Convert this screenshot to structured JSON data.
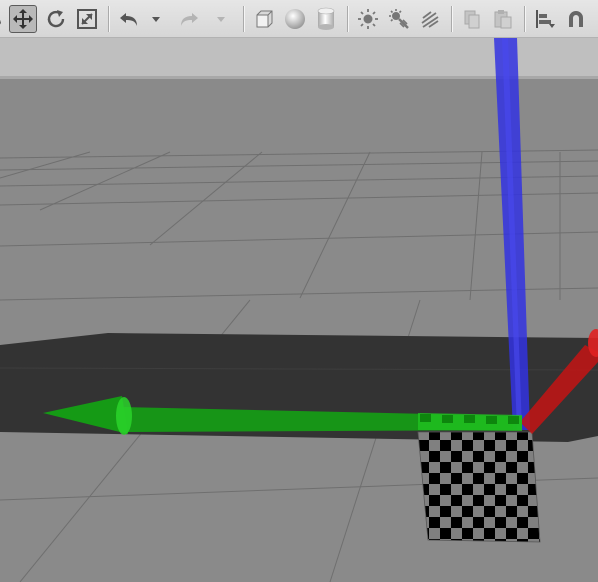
{
  "toolbar": {
    "buttons": [
      {
        "name": "select-mode",
        "icon": "arrow-cursor-icon",
        "active": false
      },
      {
        "name": "translate-mode",
        "icon": "move-arrows-icon",
        "active": true
      },
      {
        "name": "rotate-mode",
        "icon": "rotate-icon",
        "active": false
      },
      {
        "name": "scale-mode",
        "icon": "scale-icon",
        "active": false
      },
      {
        "name": "undo",
        "icon": "undo-icon",
        "active": false
      },
      {
        "name": "undo-history",
        "icon": "dropdown-arrow-icon",
        "active": false
      },
      {
        "name": "redo",
        "icon": "redo-icon",
        "active": false,
        "disabled": true
      },
      {
        "name": "redo-history",
        "icon": "dropdown-arrow-icon",
        "active": false,
        "disabled": true
      },
      {
        "name": "box-shape",
        "icon": "box-icon",
        "active": false
      },
      {
        "name": "sphere-shape",
        "icon": "sphere-icon",
        "active": false
      },
      {
        "name": "cylinder-shape",
        "icon": "cylinder-icon",
        "active": false
      },
      {
        "name": "point-light",
        "icon": "point-light-icon",
        "active": false
      },
      {
        "name": "spot-light",
        "icon": "spot-light-icon",
        "active": false
      },
      {
        "name": "directional-light",
        "icon": "directional-light-icon",
        "active": false
      },
      {
        "name": "copy",
        "icon": "copy-icon",
        "active": false,
        "disabled": true
      },
      {
        "name": "paste",
        "icon": "paste-icon",
        "active": false,
        "disabled": true
      },
      {
        "name": "align",
        "icon": "align-icon",
        "active": false
      },
      {
        "name": "snap",
        "icon": "magnet-icon",
        "active": false
      }
    ]
  },
  "scene": {
    "colors": {
      "sky": "#bfbfbf",
      "ground": "#8a8a8a",
      "grid_line": "#6f6f6f",
      "platform": "#333333",
      "x_axis": "#c41414",
      "y_axis": "#14a014",
      "z_axis": "#3333e0",
      "checker_dark": "#000000",
      "checker_light": "#808080"
    },
    "gizmo": {
      "mode": "translate",
      "axes": [
        "x-axis-red",
        "y-axis-green",
        "z-axis-blue"
      ]
    },
    "model": "checkerboard-calibration-target"
  }
}
